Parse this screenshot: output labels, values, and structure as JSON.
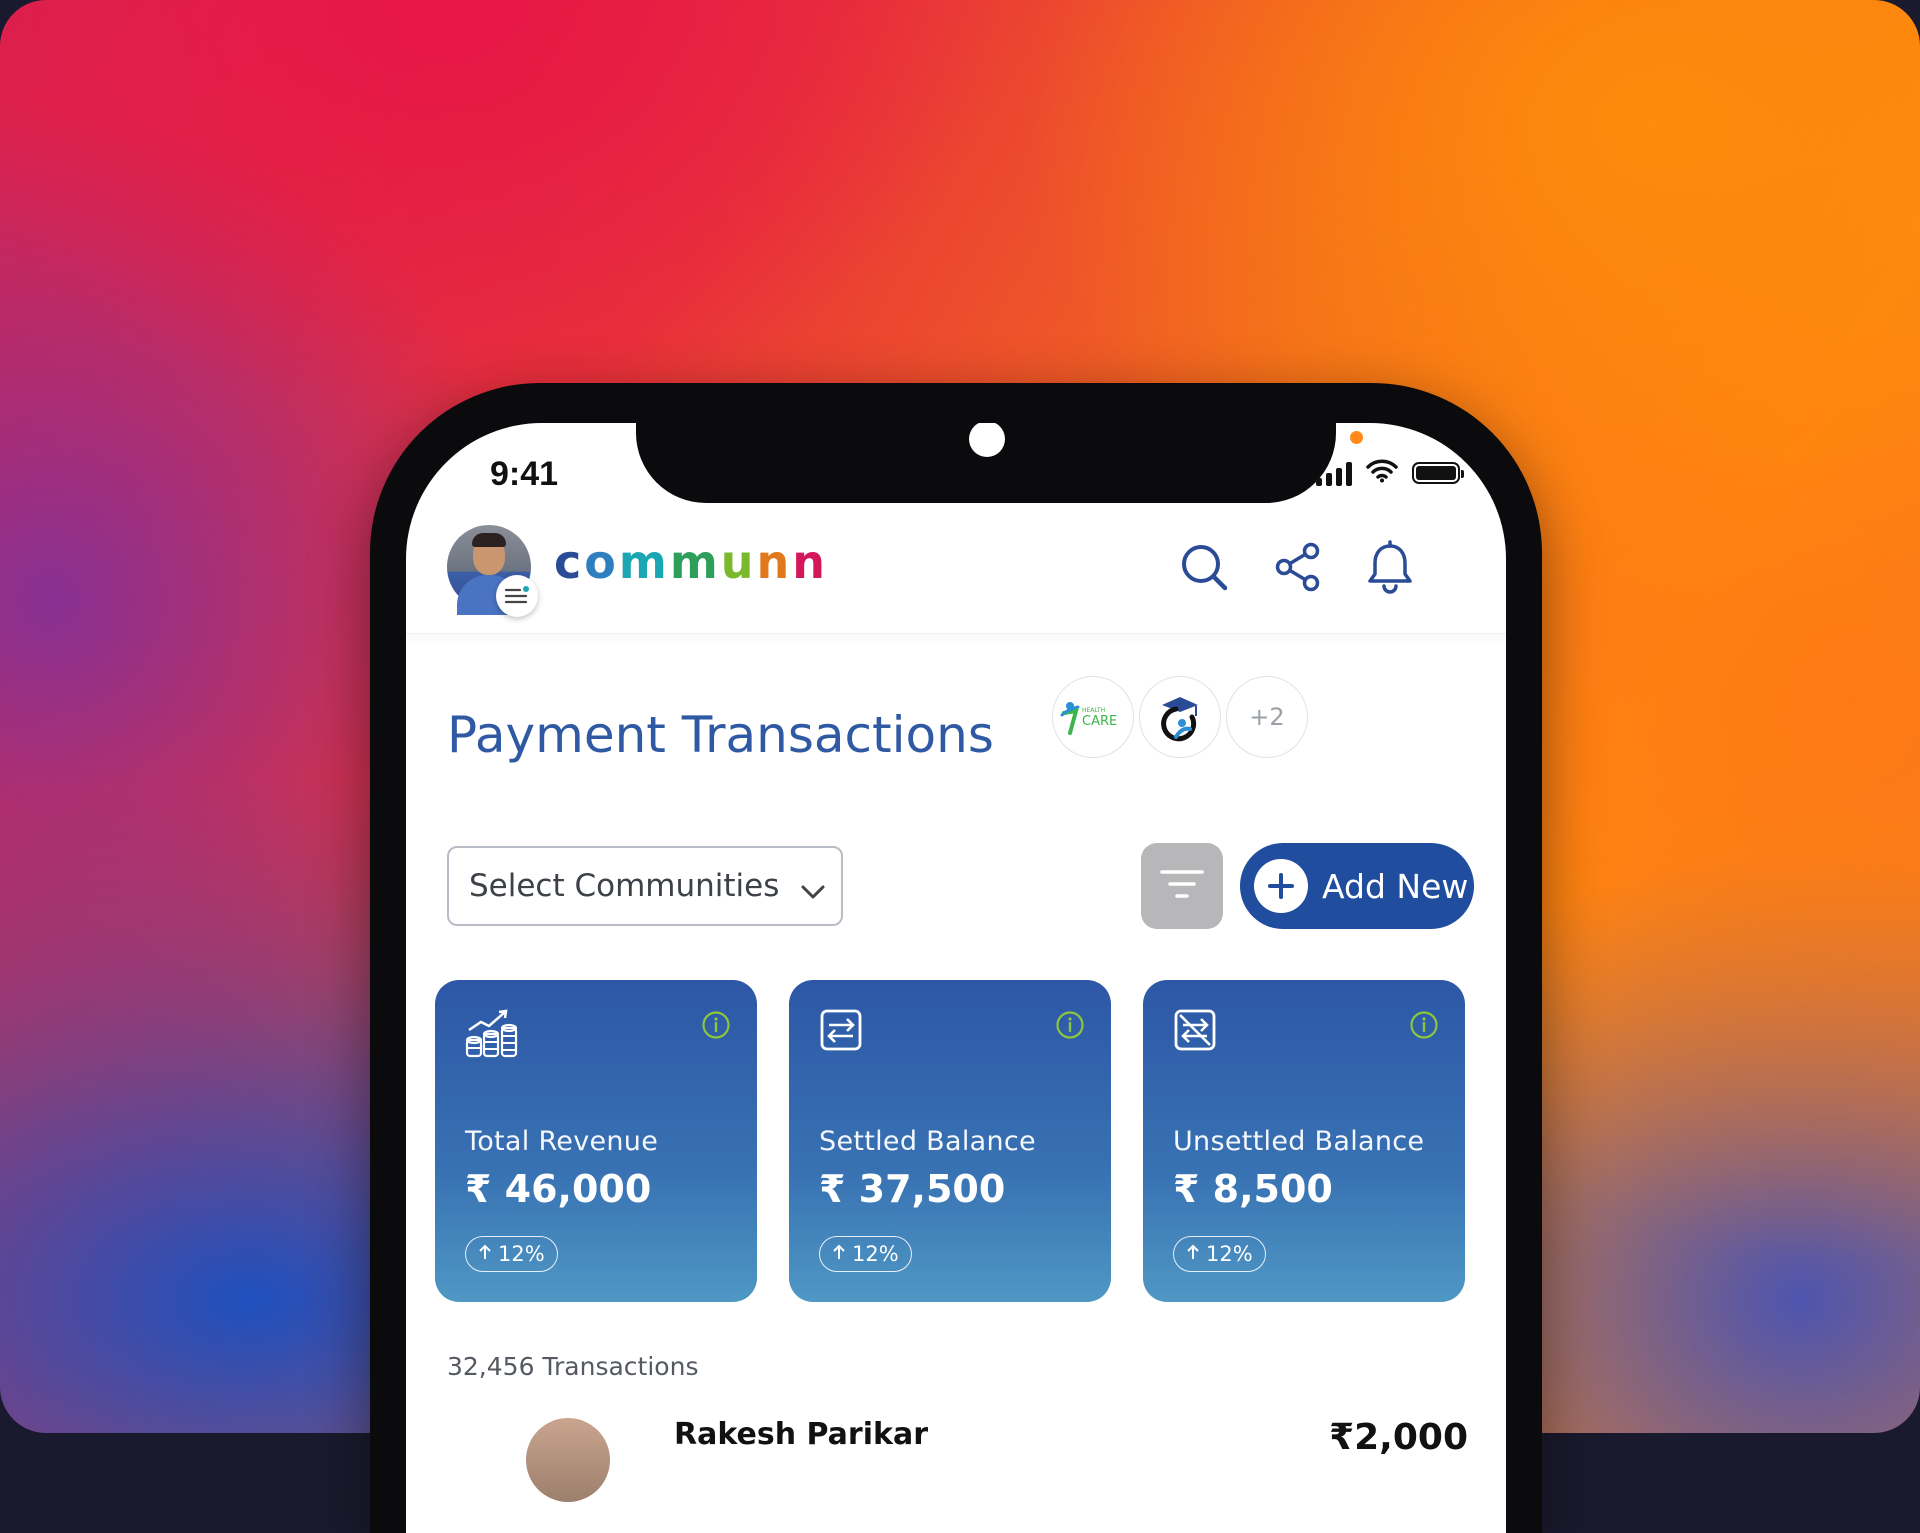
{
  "status": {
    "time": "9:41"
  },
  "header": {
    "logo_letters": [
      {
        "ch": "c",
        "color": "#2a4b96"
      },
      {
        "ch": "o",
        "color": "#2f7fc0"
      },
      {
        "ch": "m",
        "color": "#1aa6b3"
      },
      {
        "ch": "m",
        "color": "#2e9f5a"
      },
      {
        "ch": "u",
        "color": "#7ab82c"
      },
      {
        "ch": "n",
        "color": "#e0781e"
      },
      {
        "ch": "n",
        "color": "#d4175a"
      }
    ]
  },
  "page": {
    "title": "Payment Transactions",
    "communities": [
      {
        "name": "health-care-logo",
        "text": "CARE",
        "small": "HEALTH"
      },
      {
        "name": "education-logo"
      }
    ],
    "more_communities": "+2"
  },
  "controls": {
    "select_placeholder": "Select Communities",
    "add_label": "Add New"
  },
  "cards": [
    {
      "label": "Total Revenue",
      "value": "₹ 46,000",
      "change": "12%",
      "icon": "revenue-chart-icon"
    },
    {
      "label": "Settled Balance",
      "value": "₹ 37,500",
      "change": "12%",
      "icon": "transfer-icon"
    },
    {
      "label": "Unsettled Balance",
      "value": "₹ 8,500",
      "change": "12%",
      "icon": "unsettled-transfer-icon"
    }
  ],
  "transactions": {
    "count_label": "32,456 Transactions",
    "rows": [
      {
        "name": "Rakesh Parikar",
        "amount": "₹2,000"
      }
    ]
  },
  "colors": {
    "primary": "#214d9e",
    "title": "#2f5aa3",
    "info_green": "#8cc63f"
  }
}
